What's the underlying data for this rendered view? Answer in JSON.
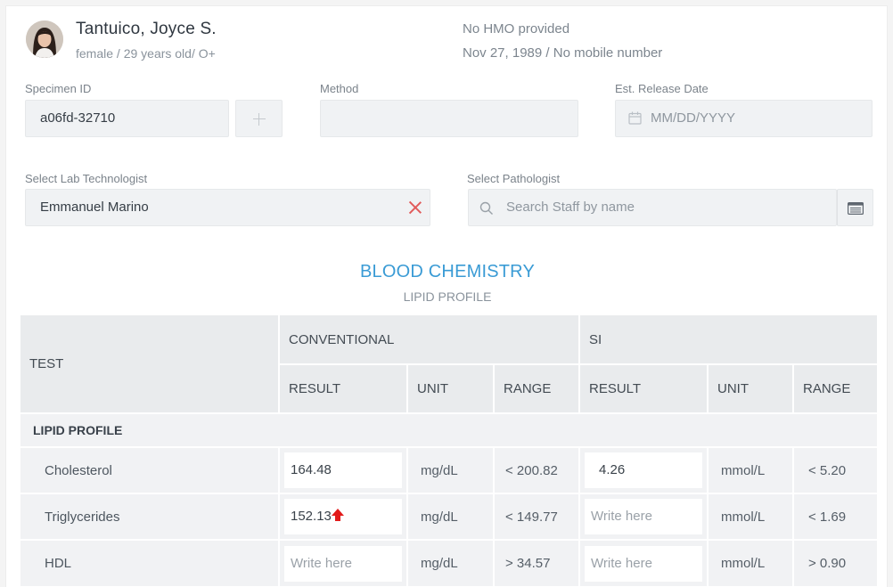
{
  "patient": {
    "name": "Tantuico, Joyce S.",
    "meta": "female / 29 years old/ O+",
    "hmo": "No HMO provided",
    "dob_mobile": "Nov 27, 1989 / No mobile number"
  },
  "fields": {
    "specimen_label": "Specimen ID",
    "specimen_value": "a06fd-32710",
    "method_label": "Method",
    "method_value": "",
    "release_label": "Est. Release Date",
    "release_placeholder": "MM/DD/YYYY",
    "technologist_label": "Select Lab Technologist",
    "technologist_value": "Emmanuel Marino",
    "pathologist_label": "Select Pathologist",
    "pathologist_placeholder": "Search Staff by name"
  },
  "section": {
    "title": "BLOOD CHEMISTRY",
    "subtitle": "LIPID PROFILE"
  },
  "table": {
    "col_test": "TEST",
    "col_conventional": "CONVENTIONAL",
    "col_si": "SI",
    "col_result": "RESULT",
    "col_unit": "UNIT",
    "col_range": "RANGE",
    "group_label": "LIPID PROFILE",
    "input_placeholder": "Write here",
    "rows": [
      {
        "test": "Cholesterol",
        "conv_result": "164.48",
        "conv_unit": "mg/dL",
        "conv_range": "< 200.82",
        "si_result": "4.26",
        "si_unit": "mmol/L",
        "si_range": "< 5.20"
      },
      {
        "test": "Triglycerides",
        "conv_result": "152.13",
        "conv_unit": "mg/dL",
        "conv_range": "< 149.77",
        "si_result": "",
        "si_unit": "mmol/L",
        "si_range": "< 1.69"
      },
      {
        "test": "HDL",
        "conv_result": "",
        "conv_unit": "mg/dL",
        "conv_range": "> 34.57",
        "si_result": "",
        "si_unit": "mmol/L",
        "si_range": "> 0.90"
      }
    ]
  },
  "colors": {
    "accent": "#3a9bd5",
    "flag_high": "#e21b1b",
    "clear_icon": "#e15b5b"
  },
  "icons": {
    "avatar": "patient-photo",
    "add": "plus-icon",
    "calendar": "calendar-icon",
    "clear": "close-icon",
    "search": "search-icon",
    "directory": "card-list-icon",
    "flag": "arrow-up-icon"
  }
}
